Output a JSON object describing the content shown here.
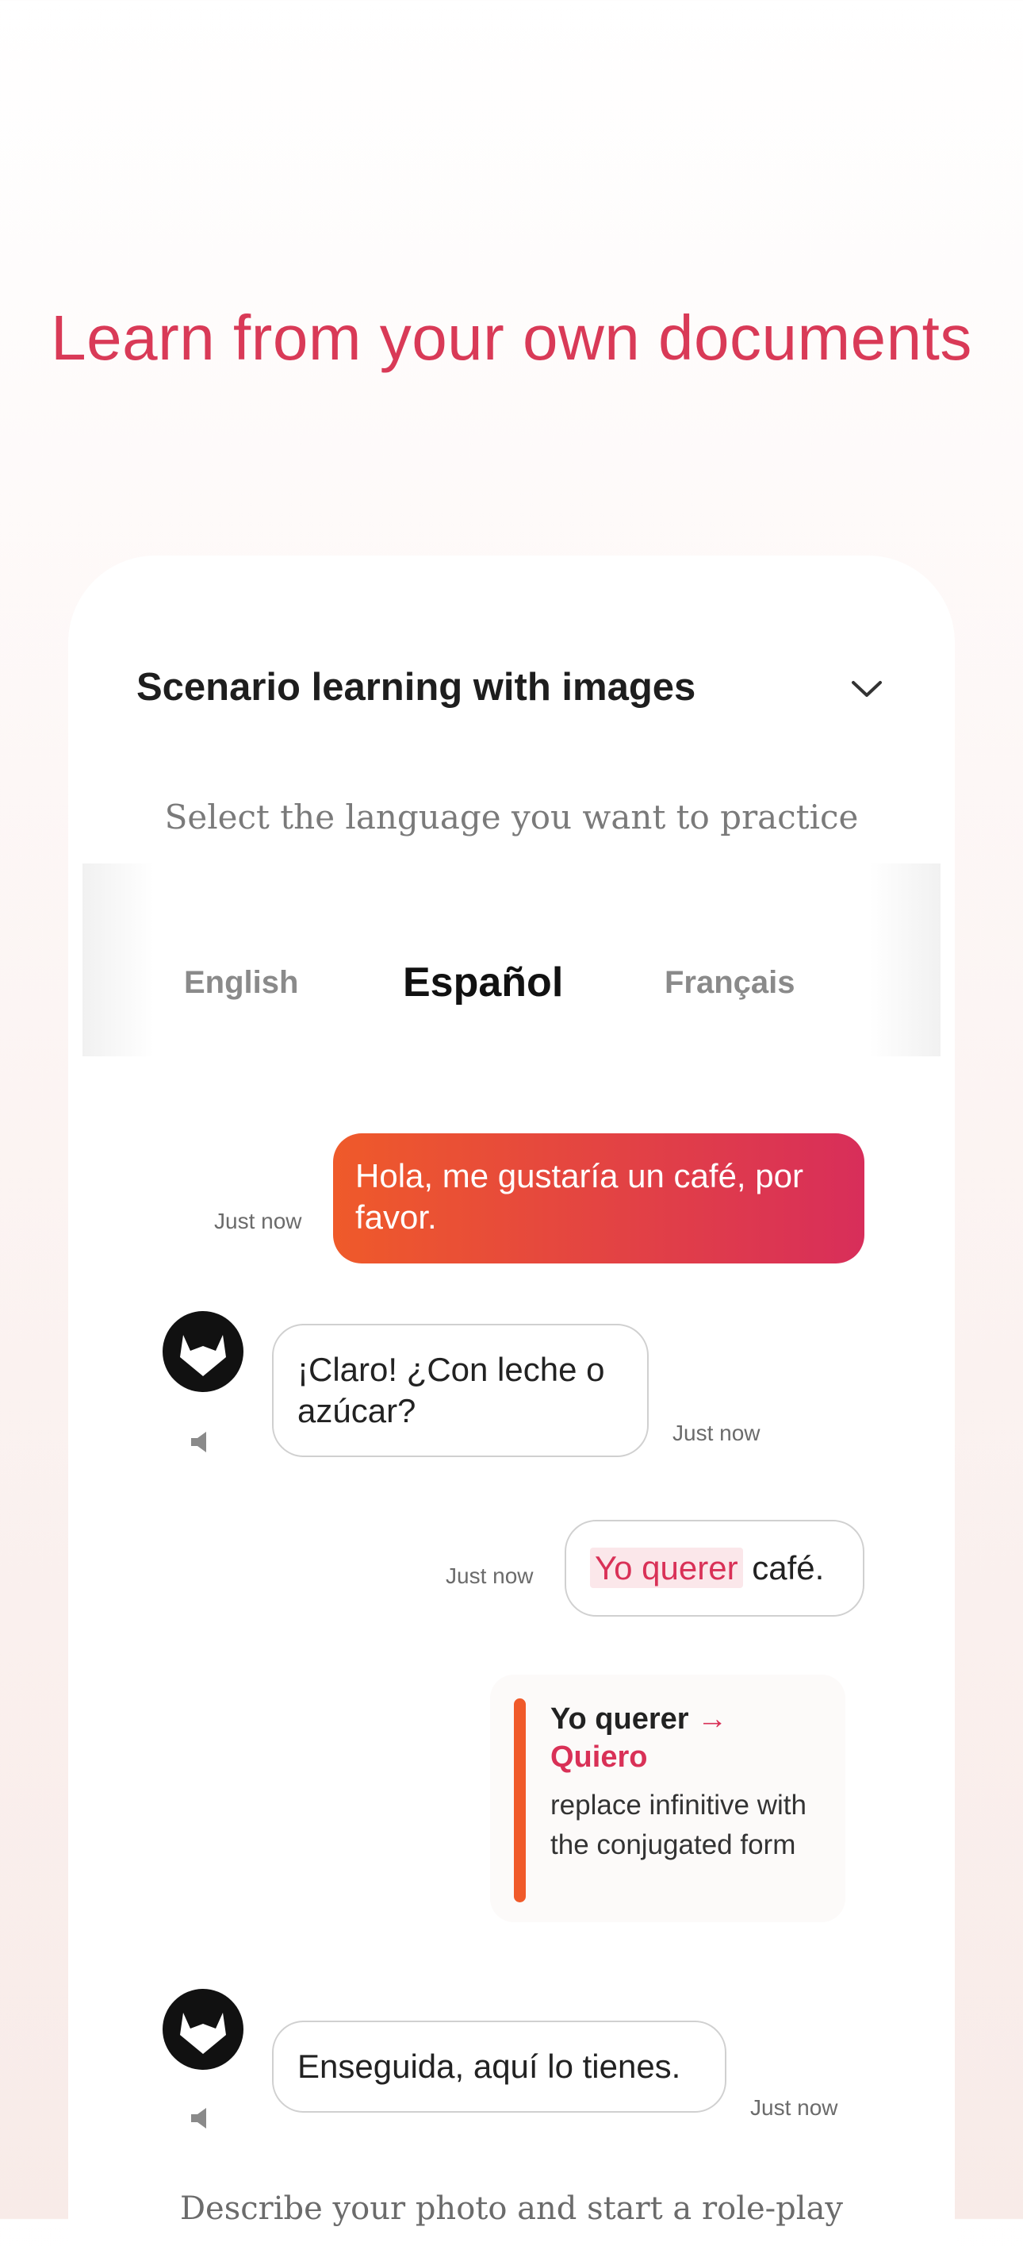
{
  "headline": "Learn from your own documents",
  "card": {
    "title": "Scenario learning with images",
    "select_hint": "Select the language you want to practice",
    "languages": [
      "English",
      "Español",
      "Français"
    ],
    "selected_language": "Español",
    "bottom_hint": "Describe your photo and start a role-play"
  },
  "chat": {
    "msg1": {
      "text": "Hola, me gustaría un café, por favor.",
      "time": "Just now"
    },
    "msg2": {
      "text": "¡Claro! ¿Con leche o azúcar?",
      "time": "Just now"
    },
    "msg3": {
      "mistake": "Yo querer",
      "rest": " café.",
      "time": "Just now"
    },
    "correction": {
      "original": "Yo querer",
      "arrow": "→",
      "fixed": "Quiero",
      "note": "replace infinitive with the conjugated form"
    },
    "msg4": {
      "text": "Enseguida, aquí lo tienes.",
      "time": "Just now"
    }
  },
  "colors": {
    "accent": "#d93a57",
    "gradient_start": "#ef5a2a",
    "gradient_end": "#d82e5a"
  },
  "icons": [
    "chevron-down-icon",
    "fox-avatar-icon",
    "speaker-icon"
  ]
}
